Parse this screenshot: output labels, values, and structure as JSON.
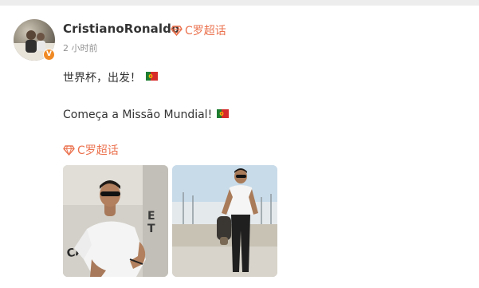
{
  "post": {
    "author": {
      "name": "CristianoRonaldo",
      "verified_badge": "V"
    },
    "super_topic_badge": "C罗超话",
    "timestamp": "2 小时前",
    "text_line1": "世界杯，出发！",
    "text_line2": "Começa a Missão Mundial!",
    "topic_link": "C罗超话",
    "flag": "portugal-flag",
    "images": [
      {
        "name": "photo-ronaldo-sunglasses-wall",
        "signage": "CASA"
      },
      {
        "name": "photo-ronaldo-walking"
      }
    ]
  },
  "colors": {
    "accent": "#eb7350",
    "text": "#333333",
    "muted": "#939393",
    "verified": "#f08a24"
  }
}
